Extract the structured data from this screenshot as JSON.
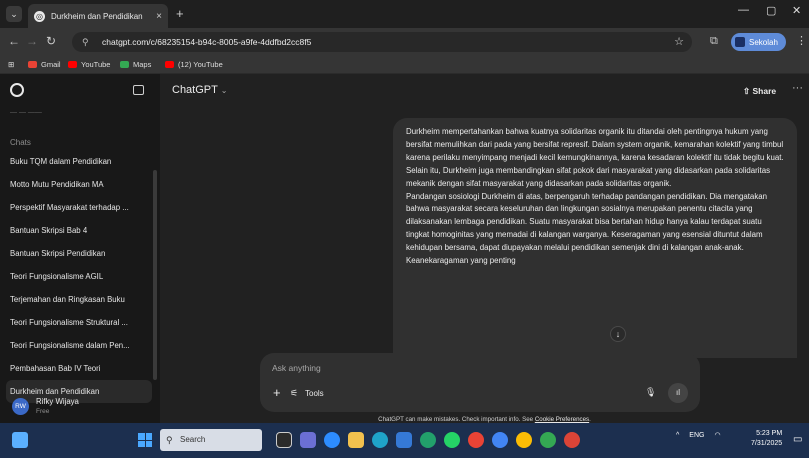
{
  "browser": {
    "tab_title": "Durkheim dan Pendidikan",
    "tab_close": "×",
    "new_tab": "+",
    "url": "chatgpt.com/c/68235154-b94c-8005-a9fe-4ddfbd2cc8f5",
    "profile_label": "Sekolah",
    "bookmarks": [
      {
        "label": "Gmail",
        "color": "#ea4335"
      },
      {
        "label": "YouTube",
        "color": "#ff0000"
      },
      {
        "label": "Maps",
        "color": "#34a853"
      },
      {
        "label": "(12) YouTube",
        "color": "#ff0000"
      }
    ]
  },
  "sidebar": {
    "section_label": "Chats",
    "chats": [
      {
        "label": "Buku TQM dalam Pendidikan",
        "active": false
      },
      {
        "label": "Motto Mutu Pendidikan MA",
        "active": false
      },
      {
        "label": "Perspektif Masyarakat terhadap ...",
        "active": false
      },
      {
        "label": "Bantuan Skripsi Bab 4",
        "active": false
      },
      {
        "label": "Bantuan Skripsi Pendidikan",
        "active": false
      },
      {
        "label": "Teori Fungsionalisme AGIL",
        "active": false
      },
      {
        "label": "Terjemahan dan Ringkasan Buku",
        "active": false
      },
      {
        "label": "Teori Fungsionalisme Struktural ...",
        "active": false
      },
      {
        "label": "Teori Fungsionalisme dalam Pen...",
        "active": false
      },
      {
        "label": "Pembahasan Bab IV Teori",
        "active": false
      },
      {
        "label": "Durkheim dan Pendidikan",
        "active": true
      }
    ],
    "user": {
      "initials": "RW",
      "name": "Rifky Wijaya",
      "plan": "Free"
    }
  },
  "header": {
    "model": "ChatGPT",
    "share_label": "Share"
  },
  "message": {
    "paragraph1": "Durkheim mempertahankan bahwa kuatnya solidaritas organik itu ditandai oleh pentingnya hukum yang bersifat memulihkan dari pada yang bersifat represif. Dalam system organik, kemarahan kolektif yang timbul karena perilaku menyimpang menjadi kecil kemungkinannya, karena kesadaran kolektif itu tidak begitu kuat. Selain itu, Durkheim juga membandingkan sifat pokok dari masyarakat yang didasarkan pada solidaritas mekanik dengan sifat masyarakat yang didasarkan pada solidaritas organik.",
    "paragraph2": "Pandangan sosiologi Durkheim di atas, berpengaruh terhadap pandangan pendidikan. Dia mengatakan bahwa masyarakat secara keseluruhan dan lingkungan sosialnya merupakan penentu citacita yang dilaksanakan lembaga pendidikan. Suatu masyarakat bisa bertahan hidup hanya kalau terdapat suatu tingkat homoginitas yang memadai di kalangan warganya. Keseragaman yang esensial dituntut dalam kehidupan bersama, dapat diupayakan melalui pendidikan semenjak dini di kalangan anak-anak. Keanekaragaman yang penting"
  },
  "composer": {
    "placeholder": "Ask anything",
    "tools_label": "Tools"
  },
  "disclaimer": {
    "text": "ChatGPT can make mistakes. Check important info. See ",
    "link": "Cookie Preferences",
    "end": "."
  },
  "taskbar": {
    "search_placeholder": "Search",
    "language": "ENG",
    "time": "5:23 PM",
    "date": "7/31/2025"
  },
  "colors": {
    "accent_profile": "#5e8bd8",
    "taskbar": "#1c2f4f",
    "bubble": "#303030"
  }
}
